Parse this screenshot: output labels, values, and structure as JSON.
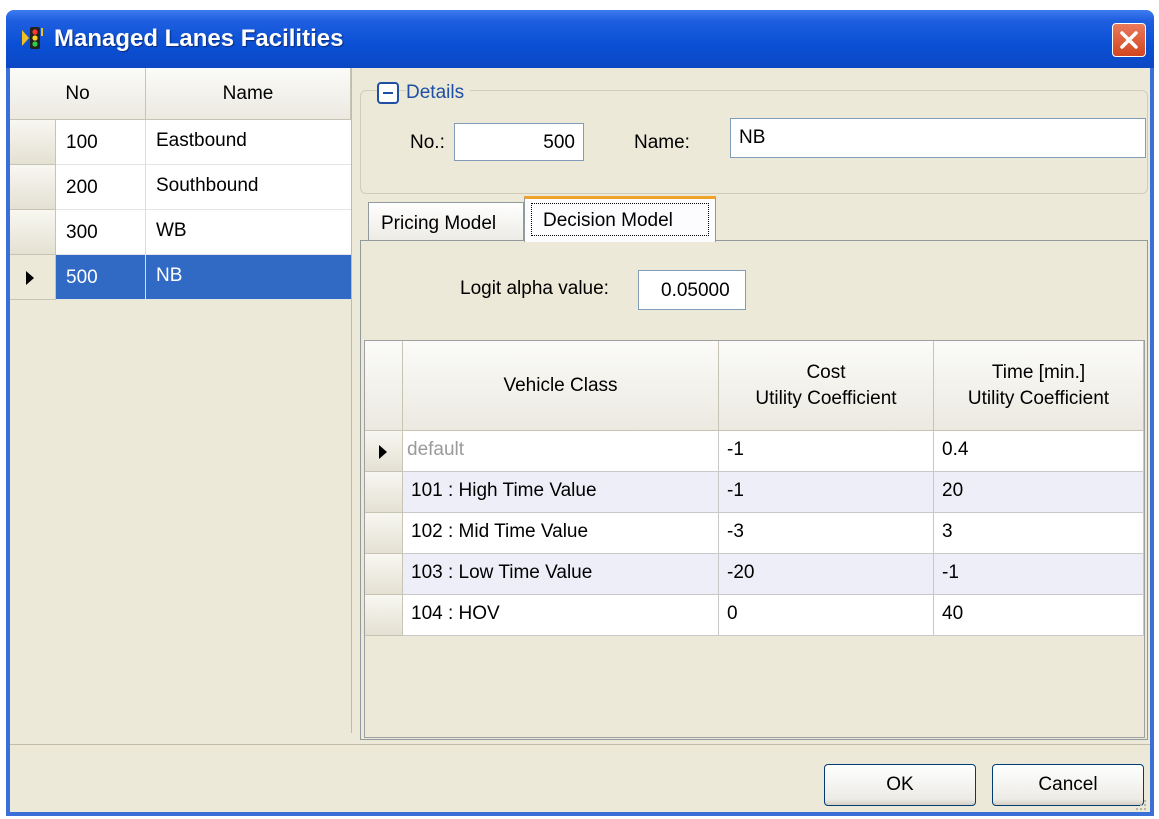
{
  "window": {
    "title": "Managed Lanes Facilities"
  },
  "list": {
    "columns": [
      "No",
      "Name"
    ],
    "rows": [
      {
        "no": "100",
        "name": "Eastbound"
      },
      {
        "no": "200",
        "name": "Southbound"
      },
      {
        "no": "300",
        "name": "WB"
      },
      {
        "no": "500",
        "name": "NB"
      }
    ],
    "selected_index": 3
  },
  "details": {
    "label": "Details",
    "no_label": "No.:",
    "no_value": "500",
    "name_label": "Name:",
    "name_value": "NB"
  },
  "tabs": [
    {
      "label": "Pricing Model",
      "active": false
    },
    {
      "label": "Decision Model",
      "active": true
    }
  ],
  "decision_model": {
    "logit_label": "Logit alpha value:",
    "logit_value": "0.05000",
    "headers": {
      "vehicle_class": "Vehicle Class",
      "cost_1": "Cost",
      "cost_2": "Utility Coefficient",
      "time_1": "Time [min.]",
      "time_2": "Utility Coefficient"
    },
    "rows": [
      {
        "vehicle_class": "default",
        "cost": "-1",
        "time": "0.4"
      },
      {
        "vehicle_class": "101 : High Time Value",
        "cost": "-1",
        "time": "20"
      },
      {
        "vehicle_class": "102 : Mid Time Value",
        "cost": "-3",
        "time": "3"
      },
      {
        "vehicle_class": "103 : Low Time Value",
        "cost": "-20",
        "time": "-1"
      },
      {
        "vehicle_class": "104 : HOV",
        "cost": "0",
        "time": "40"
      }
    ]
  },
  "buttons": {
    "ok": "OK",
    "cancel": "Cancel"
  },
  "colors": {
    "selection": "#316ac5",
    "titlebar": "#0a4fd4",
    "close": "#d2461f",
    "details_accent": "#1f4fa3",
    "active_tab": "#f0a32b"
  },
  "icons": {
    "app": "traffic-light-icon",
    "close": "close-icon",
    "collapse": "collapse-minus-icon",
    "row_marker": "row-pointer-icon"
  }
}
